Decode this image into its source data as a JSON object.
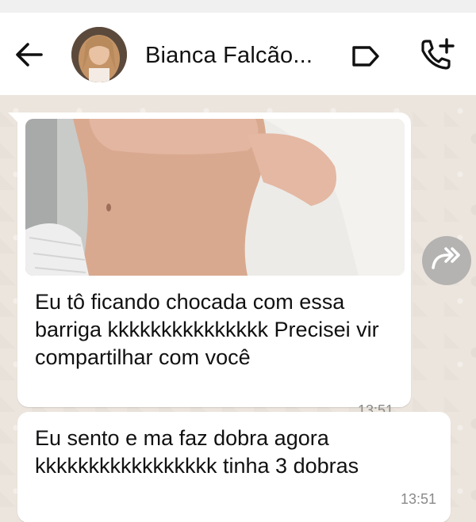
{
  "header": {
    "contact_name": "Bianca Falcão...",
    "back_icon": "arrow-left-icon",
    "label_icon": "label-tag-icon",
    "call_icon": "add-call-icon"
  },
  "messages": [
    {
      "text": "Eu tô ficando chocada com essa barriga kkkkkkkkkkkkkkk Precisei vir compartilhar com você",
      "time": "13:51",
      "has_image": true
    },
    {
      "text": "Eu sento e ma faz dobra agora kkkkkkkkkkkkkkkkk tinha 3 dobras",
      "time": "13:51"
    }
  ],
  "colors": {
    "chat_background": "#ece5dd",
    "bubble": "#ffffff",
    "header": "#ffffff"
  }
}
